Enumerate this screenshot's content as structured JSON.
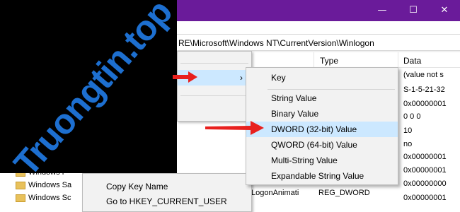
{
  "window": {
    "buttons": {
      "minimize": "—",
      "maximize": "☐",
      "close": "✕"
    }
  },
  "address": {
    "path": "RE\\Microsoft\\Windows NT\\CurrentVersion\\Winlogon"
  },
  "list": {
    "headers": {
      "type": "Type",
      "data": "Data"
    },
    "data_values": [
      "(value not s",
      "S-1-5-21-32",
      "0x00000001",
      "0 0 0",
      "0x00000001",
      "10",
      "no",
      "0x00000001",
      "0x00000001",
      "0x00000000",
      "0x00000001"
    ],
    "bottom_row": {
      "name": "LogonAnimati",
      "type": "REG_DWORD"
    }
  },
  "tree": {
    "items": [
      "Windows F",
      "Windows Sa",
      "Windows Sc"
    ]
  },
  "watermark": {
    "text": "Truongtin.top"
  },
  "context_menu": {
    "submenu_arrow": "›"
  },
  "context_menu_2": {
    "items": [
      "Copy Key Name",
      "Go to HKEY_CURRENT_USER"
    ]
  },
  "submenu": {
    "items": [
      "Key",
      "String Value",
      "Binary Value",
      "DWORD (32-bit) Value",
      "QWORD (64-bit) Value",
      "Multi-String Value",
      "Expandable String Value"
    ],
    "highlighted_index": 3
  },
  "colors": {
    "titlebar": "#6a1b9a",
    "watermark": "#1d6fd0",
    "highlight": "#cce8ff",
    "arrow": "#e8201e"
  }
}
